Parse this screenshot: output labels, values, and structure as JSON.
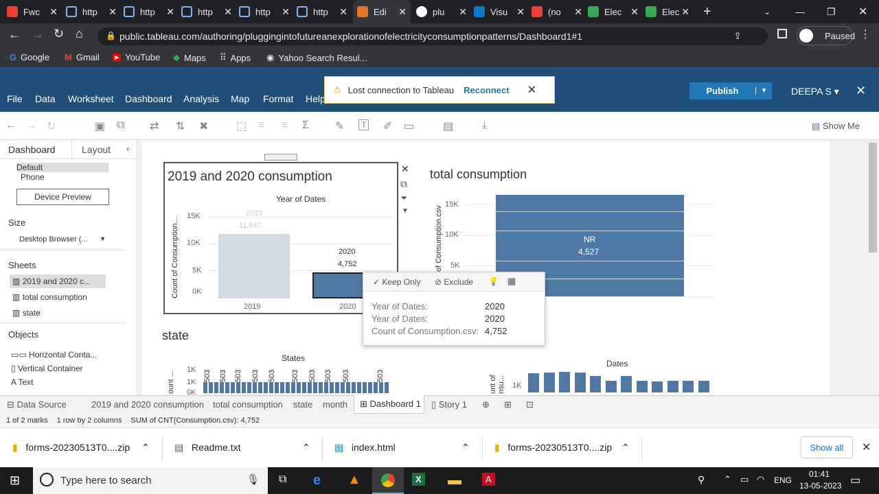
{
  "browser": {
    "tabs": [
      "Fwc",
      "http",
      "http",
      "http",
      "http",
      "http",
      "Edi",
      "plu",
      "Visu",
      "(no",
      "Elec",
      "Elec"
    ],
    "url": "public.tableau.com/authoring/pluggingintofutureanexplorationofelectricityconsumptionpatterns/Dashboard1#1",
    "profile": "Paused",
    "bookmarks": [
      "Google",
      "Gmail",
      "YouTube",
      "Maps",
      "Apps",
      "Yahoo Search Resul..."
    ]
  },
  "colors": {
    "accent": "#1f4e79",
    "bar": "#4e79a7",
    "bar_faded": "#d3dae3"
  },
  "tableau": {
    "menus": [
      "File",
      "Data",
      "Worksheet",
      "Dashboard",
      "Analysis",
      "Map",
      "Format",
      "Help"
    ],
    "alert": {
      "text": "Lost connection to Tableau",
      "action": "Reconnect"
    },
    "publish": "Publish",
    "user": "DEEPA S",
    "show_me": "Show Me",
    "left": {
      "tabs": [
        "Dashboard",
        "Layout"
      ],
      "devices": [
        "Default",
        "Phone"
      ],
      "device_preview": "Device Preview",
      "size_title": "Size",
      "size_value": "Desktop Browser (...",
      "sheets_title": "Sheets",
      "sheets": [
        "2019 and 2020 c...",
        "total consumption",
        "state"
      ],
      "objects_title": "Objects",
      "objects": [
        "Horizontal Conta...",
        "Vertical Container",
        "Text"
      ]
    },
    "bottom_tabs": [
      "Data Source",
      "2019 and 2020 consumption",
      "total consumption",
      "state",
      "month",
      "Dashboard 1",
      "Story 1"
    ],
    "status": [
      "1 of 2 marks",
      "1 row by 2 columns",
      "SUM of CNT(Consumption.csv): 4,752"
    ],
    "tooltip": {
      "actions": [
        "Keep Only",
        "Exclude"
      ],
      "rows": [
        [
          "Year of Dates:",
          "2020"
        ],
        [
          "Year of Dates:",
          "2020"
        ],
        [
          "Count of Consumption.csv:",
          "4,752"
        ]
      ]
    },
    "sheet_titles": {
      "s1": "2019 and 2020 consumption",
      "s2": "total consumption",
      "s3": "state",
      "s4_header": "Dates"
    }
  },
  "chart_data": [
    {
      "type": "bar",
      "title": "2019 and 2020 consumption",
      "xlabel": "Year of Dates",
      "ylabel": "Count of Consumption...",
      "categories": [
        "2019",
        "2020"
      ],
      "values": [
        11847,
        4752
      ],
      "value_labels": [
        "11,847",
        "4,752"
      ],
      "ylim": [
        0,
        15000
      ],
      "yticks": [
        "15K",
        "10K",
        "5K",
        "0K"
      ]
    },
    {
      "type": "bar",
      "title": "total consumption",
      "ylabel": "of Consumption.csv",
      "categories": [
        "NR"
      ],
      "values": [
        4527
      ],
      "value_labels": [
        "4,527"
      ],
      "yticks": [
        "15K",
        "10K",
        "5K"
      ]
    },
    {
      "type": "bar",
      "title": "state",
      "xlabel": "States",
      "yticks": [
        "1K",
        "1K",
        "0K"
      ],
      "ylabel": "ount ...",
      "tick_labels": [
        "503",
        "503",
        "503",
        "503",
        "503",
        "503",
        "503",
        "503",
        "503",
        "503"
      ]
    },
    {
      "type": "bar",
      "xlabel": "Dates",
      "ylabel": "unt of nsu...",
      "yticks": [
        "1K"
      ],
      "values": [
        1150,
        1200,
        1250,
        1200,
        1000,
        700,
        1000,
        700,
        650,
        700,
        700,
        700
      ]
    }
  ],
  "downloads": [
    "forms-20230513T0....zip",
    "Readme.txt",
    "index.html",
    "forms-20230513T0....zip"
  ],
  "downloads_show_all": "Show all",
  "taskbar": {
    "search": "Type here to search",
    "lang": "ENG",
    "time": "01:41",
    "date": "13-05-2023"
  }
}
